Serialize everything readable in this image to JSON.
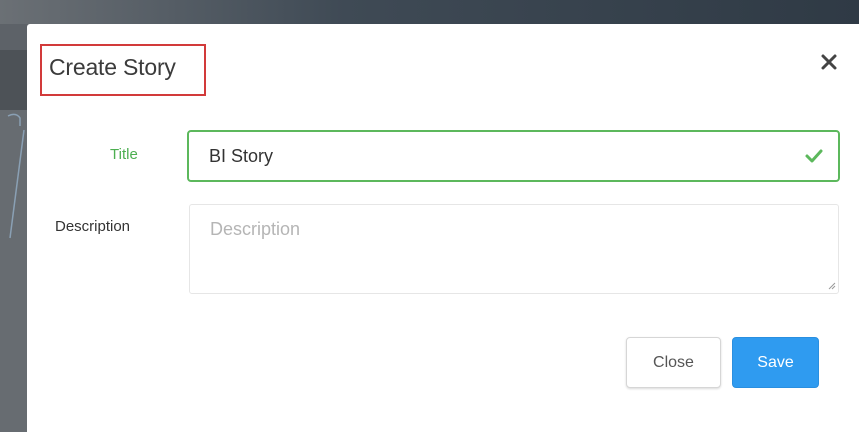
{
  "modal": {
    "title": "Create Story",
    "close_icon": "close-icon"
  },
  "form": {
    "title_label": "Title",
    "title_value": "BI Story",
    "title_valid_icon": "checkmark-icon",
    "description_label": "Description",
    "description_value": "",
    "description_placeholder": "Description"
  },
  "buttons": {
    "close_label": "Close",
    "save_label": "Save"
  },
  "colors": {
    "valid": "#5cb85c",
    "primary": "#2f9bf0",
    "highlight_box": "#d23a3a"
  }
}
